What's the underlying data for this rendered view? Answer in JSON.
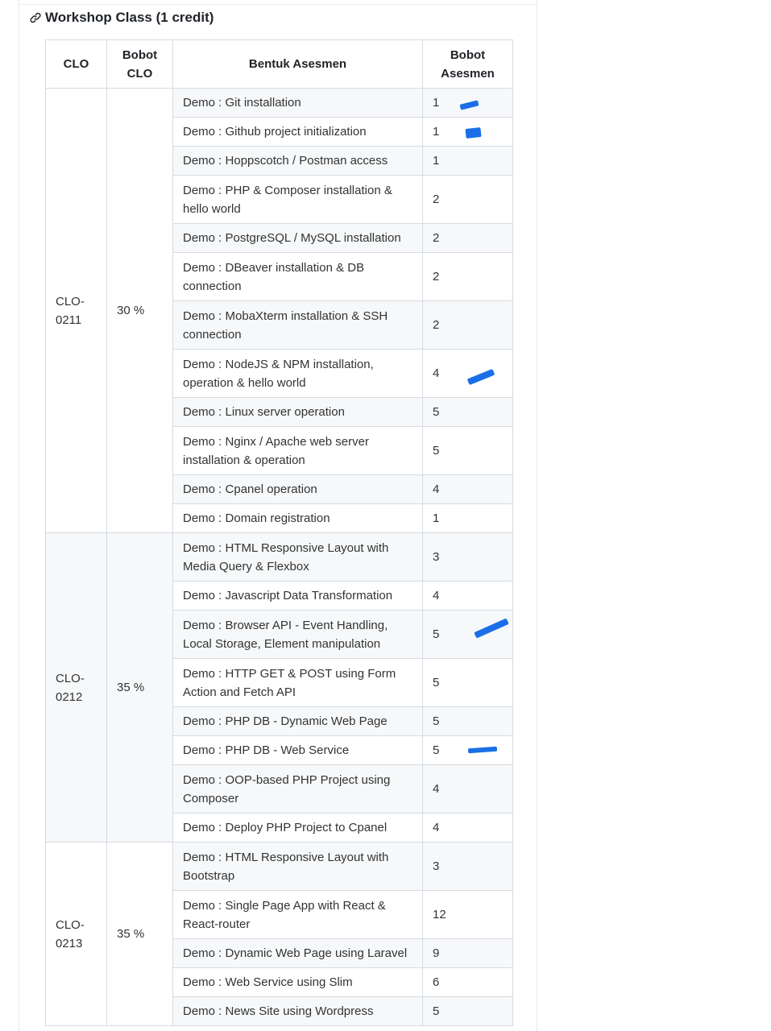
{
  "section": {
    "title": "Workshop Class (1 credit)",
    "icon": "link-icon"
  },
  "table": {
    "headers": {
      "clo": "CLO",
      "bobot_clo": "Bobot CLO",
      "bentuk_asesmen": "Bentuk Asesmen",
      "bobot_asesmen": "Bobot Asesmen"
    },
    "groups": [
      {
        "clo": "CLO-0211",
        "bobot": "30 %",
        "rows": [
          {
            "bentuk": "Demo : Git installation",
            "bobot": "1"
          },
          {
            "bentuk": "Demo : Github project initialization",
            "bobot": "1"
          },
          {
            "bentuk": "Demo : Hoppscotch / Postman access",
            "bobot": "1"
          },
          {
            "bentuk": "Demo : PHP & Composer installation & hello world",
            "bobot": "2"
          },
          {
            "bentuk": "Demo : PostgreSQL / MySQL installation",
            "bobot": "2"
          },
          {
            "bentuk": "Demo : DBeaver installation & DB connection",
            "bobot": "2"
          },
          {
            "bentuk": "Demo : MobaXterm installation & SSH connection",
            "bobot": "2"
          },
          {
            "bentuk": "Demo : NodeJS & NPM installation, operation & hello world",
            "bobot": "4"
          },
          {
            "bentuk": "Demo : Linux server operation",
            "bobot": "5"
          },
          {
            "bentuk": "Demo : Nginx / Apache web server installation & operation",
            "bobot": "5"
          },
          {
            "bentuk": "Demo : Cpanel operation",
            "bobot": "4"
          },
          {
            "bentuk": "Demo : Domain registration",
            "bobot": "1"
          }
        ]
      },
      {
        "clo": "CLO-0212",
        "bobot": "35 %",
        "rows": [
          {
            "bentuk": "Demo : HTML Responsive Layout with Media Query & Flexbox",
            "bobot": "3"
          },
          {
            "bentuk": "Demo : Javascript Data Transformation",
            "bobot": "4"
          },
          {
            "bentuk": "Demo : Browser API - Event Handling, Local Storage, Element manipulation",
            "bobot": "5"
          },
          {
            "bentuk": "Demo : HTTP GET & POST using Form Action and Fetch API",
            "bobot": "5"
          },
          {
            "bentuk": "Demo : PHP DB - Dynamic Web Page",
            "bobot": "5"
          },
          {
            "bentuk": "Demo : PHP DB - Web Service",
            "bobot": "5"
          },
          {
            "bentuk": "Demo : OOP-based PHP Project using Composer",
            "bobot": "4"
          },
          {
            "bentuk": "Demo : Deploy PHP Project to Cpanel",
            "bobot": "4"
          }
        ]
      },
      {
        "clo": "CLO-0213",
        "bobot": "35 %",
        "rows": [
          {
            "bentuk": "Demo : HTML Responsive Layout with Bootstrap",
            "bobot": "3"
          },
          {
            "bentuk": "Demo : Single Page App with React & React-router",
            "bobot": "12"
          },
          {
            "bentuk": "Demo : Dynamic Web Page using Laravel",
            "bobot": "9"
          },
          {
            "bentuk": "Demo : Web Service using Slim",
            "bobot": "6"
          },
          {
            "bentuk": "Demo : News Site using Wordpress",
            "bobot": "5"
          }
        ]
      }
    ]
  },
  "colors": {
    "border": "#d6dadf",
    "stripe": "#f6f8fa",
    "pen_marks": "#1a6fe8"
  }
}
